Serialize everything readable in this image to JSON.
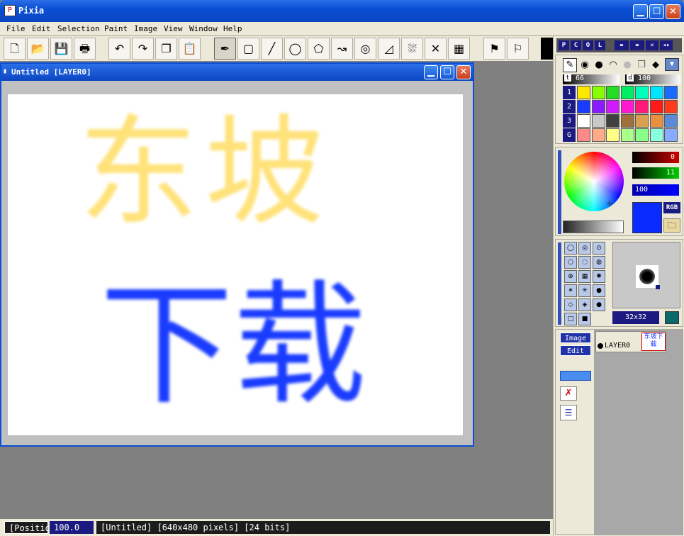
{
  "app": {
    "title": "Pixia",
    "icon": "app-icon"
  },
  "menu": [
    "File",
    "Edit",
    "Selection",
    "Paint",
    "Image",
    "View",
    "Window",
    "Help"
  ],
  "toolbar": {
    "icons": [
      "new-file-icon",
      "open-folder-icon",
      "save-icon",
      "print-icon",
      "undo-icon",
      "redo-icon",
      "copy-icon",
      "paste-icon",
      "pen-tool-icon",
      "rectangle-icon",
      "line-icon",
      "circle-icon",
      "fill-icon",
      "bezier-icon",
      "lasso-icon",
      "polygon-select-icon",
      "bucket-icon",
      "clear-selection-icon",
      "transparency-icon",
      "paint-red-icon",
      "paint-dark-icon"
    ],
    "glyphs": [
      "🗋",
      "📂",
      "💾",
      "🖶",
      "↶",
      "↷",
      "❐",
      "📋",
      "✒",
      "▢",
      "╱",
      "◯",
      "⬠",
      "↝",
      "◎",
      "◿",
      "⛆",
      "✕",
      "▦",
      "⚑",
      "⚐"
    ]
  },
  "document": {
    "title": "Untitled [LAYER0]"
  },
  "canvas_text": {
    "top": "东坡",
    "bottom": "下载"
  },
  "status": {
    "position": "[Positio",
    "zoom": "100.0",
    "info": "[Untitled] [640x480 pixels] [24 bits]"
  },
  "panel": {
    "tabs": [
      "P",
      "C",
      "O",
      "L"
    ],
    "size_label": "t",
    "size_value": "66",
    "density_label": "d",
    "density_value": "100",
    "palette_rows": [
      "1",
      "2",
      "3",
      "G"
    ],
    "palette": [
      [
        "#ffe800",
        "#88ff00",
        "#22dd22",
        "#00ee66",
        "#00ffbb",
        "#00e5ff",
        "#1a6cff"
      ],
      [
        "#1a3cff",
        "#8a1aff",
        "#d11aff",
        "#ff1ad1",
        "#ff1a7a",
        "#ff1a1a",
        "#ff3a1a"
      ],
      [
        "#ffffff",
        "#c8c8c8",
        "#404040",
        "#a0703c",
        "#d8a050",
        "#e89040",
        "#5a8ad8"
      ],
      [
        "#ff8888",
        "#ffaa88",
        "#ffff88",
        "#aaff88",
        "#88ff88",
        "#88ffdd",
        "#88aaff"
      ]
    ],
    "r_value": "0",
    "g_value": "11",
    "b_value": "100",
    "rgb_label": "RGB",
    "current_color": "#0a2bff",
    "brush_size": "32x32",
    "layer_tabs": [
      "Image",
      "Edit"
    ],
    "layer_name": "LAYER0",
    "thumb_text": "东坡下载"
  }
}
